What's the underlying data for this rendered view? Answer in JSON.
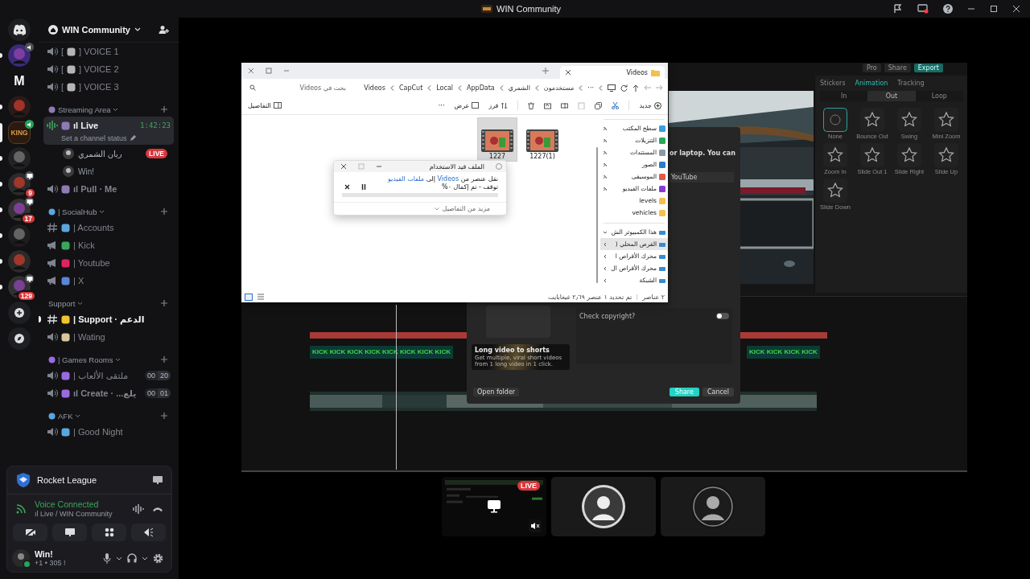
{
  "top_bar": {
    "title": "WIN Community"
  },
  "servers": [
    {
      "kind": "home",
      "selected": false,
      "unread": false
    },
    {
      "kind": "avatar",
      "selected": false,
      "unread": true,
      "voice_indicator": true
    },
    {
      "kind": "letter",
      "text": "M",
      "selected": false,
      "unread": false
    },
    {
      "kind": "avatar",
      "selected": false,
      "unread": true
    },
    {
      "kind": "logo",
      "text": "KING",
      "selected": true,
      "unread": false,
      "voice_indicator": true
    },
    {
      "kind": "avatar",
      "selected": false,
      "unread": true
    },
    {
      "kind": "avatar",
      "selected": false,
      "unread": true,
      "screen_indicator": true,
      "badge": "9"
    },
    {
      "kind": "avatar",
      "selected": false,
      "unread": true,
      "screen_indicator": true,
      "badge": "17"
    },
    {
      "kind": "avatar",
      "selected": false,
      "unread": true
    },
    {
      "kind": "avatar",
      "selected": false,
      "unread": true
    },
    {
      "kind": "avatar",
      "selected": false,
      "unread": true,
      "screen_indicator": true,
      "badge": "129"
    }
  ],
  "server_header": {
    "name": "WIN Community"
  },
  "channels": [
    {
      "kind": "voice",
      "prefix": "[",
      "name": "] VOICE 1",
      "selected": false,
      "bold": false,
      "unread": false
    },
    {
      "kind": "voice",
      "prefix": "[",
      "name": "] VOICE 2",
      "selected": false,
      "bold": false,
      "unread": false
    },
    {
      "kind": "voice",
      "prefix": "[",
      "name": "] VOICE 3",
      "selected": false,
      "bold": false,
      "unread": false
    },
    {
      "kind": "category",
      "name": "Streaming Area"
    },
    {
      "kind": "voice",
      "name": "ıl Live",
      "selected": true,
      "bold": true,
      "unread": false,
      "time": "1:42:23",
      "status": "Set a channel status",
      "members": [
        {
          "name": "ريان الشمري",
          "live": true,
          "live_label": "LIVE"
        },
        {
          "name": "Win!",
          "live": false
        }
      ]
    },
    {
      "kind": "voice",
      "name": "ıl Pull · Me",
      "selected": false,
      "bold": true,
      "unread": false
    },
    {
      "kind": "category",
      "name": "| SocialHub"
    },
    {
      "kind": "text",
      "name": "| Accounts",
      "selected": false,
      "bold": false,
      "unread": false
    },
    {
      "kind": "announce",
      "name": "| Kick",
      "selected": false,
      "bold": false,
      "unread": false
    },
    {
      "kind": "announce",
      "name": "| Youtube",
      "selected": false,
      "bold": false,
      "unread": false
    },
    {
      "kind": "announce",
      "name": "| X",
      "selected": false,
      "bold": false,
      "unread": false
    },
    {
      "kind": "category",
      "name": "Support"
    },
    {
      "kind": "text",
      "name": "| Support · الدعم",
      "selected": false,
      "bold": true,
      "unread": true
    },
    {
      "kind": "voice",
      "name": "| Wating",
      "selected": false,
      "bold": false,
      "unread": false
    },
    {
      "kind": "category",
      "name": "| Games Rooms"
    },
    {
      "kind": "voice",
      "name": "| ملتقى الألعاب",
      "selected": false,
      "bold": false,
      "unread": false,
      "counts": [
        "00",
        "20"
      ]
    },
    {
      "kind": "voice",
      "name": "ıl Create · ...يلع",
      "selected": false,
      "bold": true,
      "unread": false,
      "counts": [
        "00",
        "01"
      ]
    },
    {
      "kind": "category",
      "name": "AFK"
    },
    {
      "kind": "voice",
      "name": "| Good Night",
      "selected": false,
      "bold": false,
      "unread": false
    }
  ],
  "activity": {
    "game": "Rocket League"
  },
  "voice": {
    "status": "Voice Connected",
    "channel": "ıl Live / WIN Community"
  },
  "user": {
    "name": "Win!",
    "status": "+1 • 305 !"
  },
  "stream": {
    "explorer": {
      "tab_title": "Videos",
      "breadcrumbs": [
        "Videos",
        "CapCut",
        "Local",
        "AppData",
        "الشمري",
        "مستخدمون",
        "···"
      ],
      "search_placeholder": "بحث في Videos",
      "toolbar": [
        "جديد",
        "فرز",
        "عرض",
        "···",
        "التفاصيل"
      ],
      "files": [
        {
          "name": "1227",
          "selected": true
        },
        {
          "name": "1227(1)",
          "selected": false
        }
      ],
      "quick_access": [
        {
          "label": "سطح المكتب",
          "pinned": true
        },
        {
          "label": "التنزيلات",
          "pinned": true
        },
        {
          "label": "المستندات",
          "pinned": true
        },
        {
          "label": "الصور",
          "pinned": true
        },
        {
          "label": "الموسيقى",
          "pinned": true
        },
        {
          "label": "ملفات الفيديو",
          "pinned": true
        },
        {
          "label": "levels",
          "pinned": false
        },
        {
          "label": "vehicles",
          "pinned": false
        }
      ],
      "tree": [
        {
          "label": "هذا الكمبيوتر الش",
          "expanded": true,
          "selected": false
        },
        {
          "label": "القرص المحلي (",
          "expanded": false,
          "selected": true
        },
        {
          "label": "محرك الأقراص ا",
          "expanded": false,
          "selected": false
        },
        {
          "label": "محرك الأقراص ال",
          "expanded": false,
          "selected": false
        },
        {
          "label": "الشبكة",
          "expanded": false,
          "selected": false
        }
      ],
      "status": [
        "٢ عناصر",
        "تم تحديد ١ عنصر ٢٫٦٩ غيغابايت"
      ],
      "dialog": {
        "title": "الملف قيد الاستخدام",
        "message": [
          {
            "text": "نقل عنصر من ",
            "link": false
          },
          {
            "text": "Videos",
            "link": true
          },
          {
            "text": " إلى ",
            "link": false
          },
          {
            "text": "ملفات الفيديو",
            "link": true
          }
        ],
        "progress_text": "توقف - تم إكمال ٠%",
        "level": 0,
        "details": "مزيد من التفاصيل"
      }
    },
    "capcut": {
      "top_buttons": [
        "Pro",
        "Share",
        "Export"
      ],
      "tabs": [
        {
          "label": "Stickers",
          "selected": false
        },
        {
          "label": "Animation",
          "selected": true
        },
        {
          "label": "Tracking",
          "selected": false
        }
      ],
      "subtabs": [
        {
          "label": "In",
          "selected": false
        },
        {
          "label": "Out",
          "selected": true
        },
        {
          "label": "Loop",
          "selected": false
        }
      ],
      "animations": [
        {
          "label": "None",
          "selected": true
        },
        {
          "label": "Bounce Out",
          "selected": false
        },
        {
          "label": "Swing",
          "selected": false
        },
        {
          "label": "Mini Zoom",
          "selected": false
        },
        {
          "label": "Zoom In",
          "selected": false
        },
        {
          "label": "Slide Out 1",
          "selected": false
        },
        {
          "label": "Slide Right",
          "selected": false
        },
        {
          "label": "Slide Up",
          "selected": false
        },
        {
          "label": "Slide Down",
          "selected": false
        }
      ],
      "export": {
        "heading": "or laptop. You can",
        "platform": "YouTube",
        "copyright_label": "Check copyright?",
        "copyright_on": false,
        "promo_title": "Long video to shorts",
        "promo_text": "Get multiple, viral short videos from 1 long video in 1 click.",
        "open_folder": "Open folder",
        "share": "Share",
        "cancel": "Cancel"
      },
      "timeline_clips": [
        "KICK KICK KICK KICK KICK KICK KICK KICK",
        "KICK KICK KICK KICK"
      ]
    }
  },
  "participants": [
    {
      "kind": "stream",
      "live_label": "LIVE",
      "muted": true
    },
    {
      "kind": "avatar"
    },
    {
      "kind": "avatar"
    }
  ]
}
